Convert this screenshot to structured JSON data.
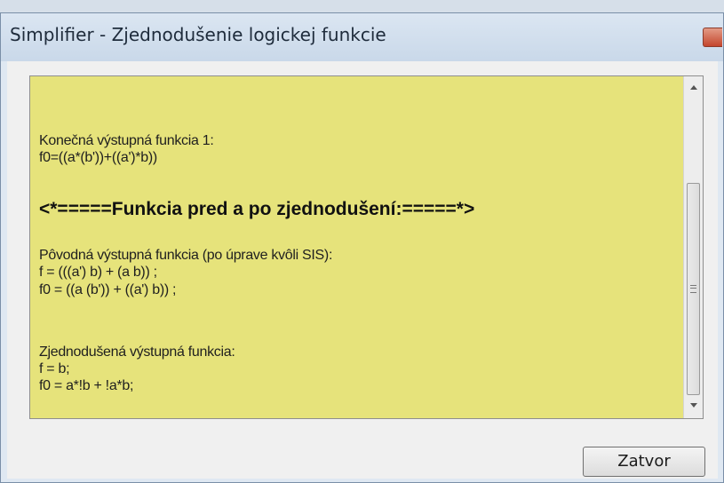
{
  "window": {
    "title": "Simplifier - Zjednodušenie logickej funkcie"
  },
  "output": {
    "lines": [
      "Konečná výstupná funkcia 1:",
      "f0=((a*(b'))+((a')*b))",
      "<*=====Funkcia pred a po zjednodušení:=====*>",
      " Pôvodná výstupná funkcia (po úprave kvôli SIS):",
      "f = (((a') b) + (a b)) ;",
      "f0 = ((a (b')) + ((a') b)) ;",
      "Zjednodušená výstupná funkcia:",
      "f = b;",
      "f0 = a*!b + !a*b;"
    ],
    "background_color": "#e6e37b"
  },
  "scrollbar": {
    "up_icon": "arrow-up",
    "down_icon": "arrow-down",
    "grip_icon": "grip-lines"
  },
  "buttons": {
    "close_label": "Zatvor"
  }
}
